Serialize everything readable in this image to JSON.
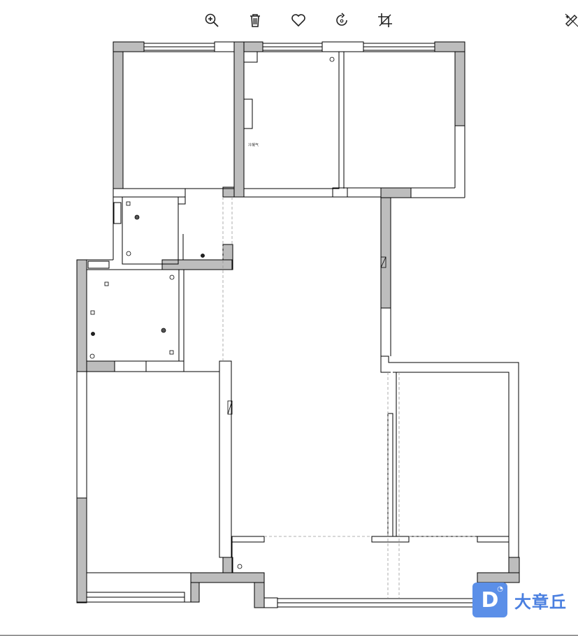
{
  "toolbar": {
    "buttons": [
      {
        "icon": "zoom-in-icon"
      },
      {
        "icon": "trash-icon"
      },
      {
        "icon": "heart-icon"
      },
      {
        "icon": "rotate-icon"
      },
      {
        "icon": "crop-icon"
      }
    ],
    "edit_icon": "magic-edit-icon"
  },
  "plan": {
    "room_label": "冷凝气",
    "colors": {
      "wall": "#bdbdbd",
      "line": "#000000",
      "dash": "#999999"
    }
  },
  "brand": {
    "logo_letter": "D",
    "name": "大章丘"
  }
}
